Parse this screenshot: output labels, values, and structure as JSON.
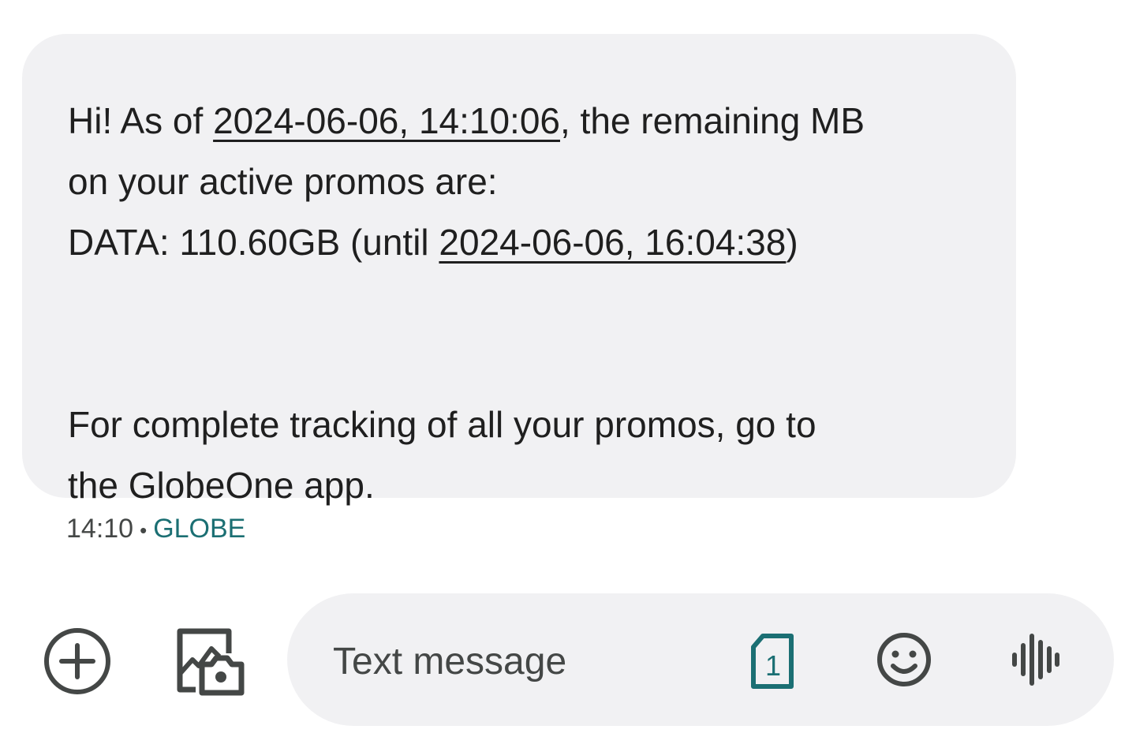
{
  "message": {
    "line1_prefix": "Hi! As of ",
    "line1_link": "2024-06-06, 14:10:06",
    "line1_suffix": ", the remaining MB",
    "line2": "on your active promos are:",
    "line3_prefix": "DATA: 110.60GB (until ",
    "line3_link": "2024-06-06, 16:04:38",
    "line3_suffix": ")",
    "line4": "For complete tracking of all your promos, go to",
    "line5": "the GlobeOne app."
  },
  "meta": {
    "time": "14:10",
    "separator": "•",
    "sender": "GLOBE"
  },
  "composer": {
    "placeholder": "Text message",
    "sim_number": "1",
    "icons": [
      "add-icon",
      "gallery-camera-icon",
      "sim-card-icon",
      "emoji-icon",
      "voice-waveform-icon"
    ]
  },
  "colors": {
    "bubble_bg": "#f1f1f3",
    "text": "#1f1f1f",
    "sender_accent": "#1b6f73",
    "icon": "#444746"
  }
}
